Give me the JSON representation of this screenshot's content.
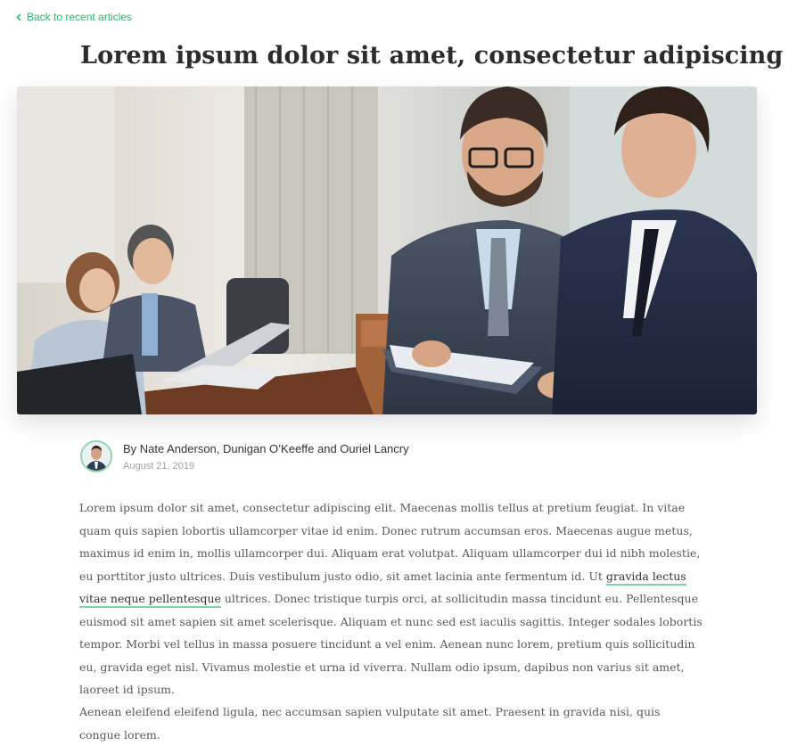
{
  "nav": {
    "back_label": "Back to recent articles"
  },
  "article": {
    "title": "Lorem ipsum dolor sit amet, consectetur adipiscing",
    "authors": "By Nate Anderson, Dunigan O’Keeffe and Ouriel Lancry",
    "date": "August 21, 2019",
    "p1_before_link": "Lorem ipsum dolor sit amet, consectetur adipiscing elit. Maecenas mollis tellus at pretium feugiat. In vitae quam quis sapien lobortis ullamcorper vitae id enim. Donec rutrum accumsan eros. Maecenas augue metus, maximus id enim in, mollis ullamcorper dui. Aliquam erat volutpat. Aliquam ullamcorper dui id nibh molestie, eu porttitor justo ultrices. Duis vestibulum justo odio, sit amet lacinia ante fermentum id. Ut ",
    "p1_link": "gravida lectus vitae neque pellentesque",
    "p1_after_link": " ultrices. Donec tristique turpis orci, at sollicitudin massa tincidunt eu. Pellentesque euismod sit amet sapien sit amet scelerisque. Aliquam et nunc sed est iaculis sagittis. Integer sodales lobortis tempor. Morbi vel tellus in massa posuere tincidunt a vel enim. Aenean nunc lorem, pretium quis sollicitudin eu, gravida eget nisl. Vivamus molestie et urna id viverra. Nullam odio ipsum, dapibus non varius sit amet, laoreet id ipsum.",
    "p2": "Aenean eleifend eleifend ligula, nec accumsan sapien vulputate sit amet. Praesent in gravida nisi, quis congue lorem."
  },
  "colors": {
    "accent": "#2bb56b",
    "link_underline": "#7ad6a5",
    "title": "#2c2c2c",
    "body": "#5a5a5a"
  },
  "icons": {
    "back": "chevron-left-icon"
  }
}
